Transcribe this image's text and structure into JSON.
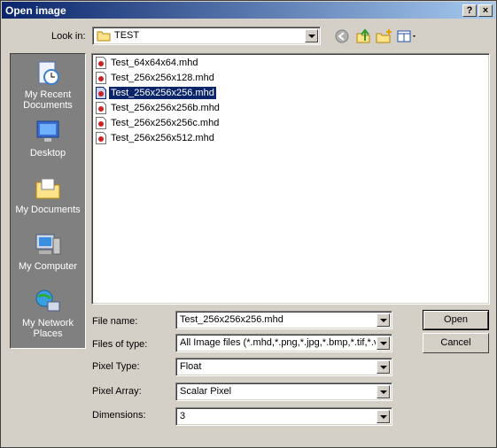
{
  "window": {
    "title": "Open image"
  },
  "titlebar": {
    "help": "?",
    "close": "×"
  },
  "lookin": {
    "label": "Look in:",
    "value": "TEST"
  },
  "places": [
    {
      "label": "My Recent Documents",
      "icon": "recent-documents-icon"
    },
    {
      "label": "Desktop",
      "icon": "desktop-icon"
    },
    {
      "label": "My Documents",
      "icon": "my-documents-icon"
    },
    {
      "label": "My Computer",
      "icon": "my-computer-icon"
    },
    {
      "label": "My Network Places",
      "icon": "network-places-icon"
    }
  ],
  "files": [
    {
      "name": "Test_64x64x64.mhd",
      "selected": false
    },
    {
      "name": "Test_256x256x128.mhd",
      "selected": false
    },
    {
      "name": "Test_256x256x256.mhd",
      "selected": true
    },
    {
      "name": "Test_256x256x256b.mhd",
      "selected": false
    },
    {
      "name": "Test_256x256x256c.mhd",
      "selected": false
    },
    {
      "name": "Test_256x256x512.mhd",
      "selected": false
    }
  ],
  "form": {
    "filename_label": "File name:",
    "filename_value": "Test_256x256x256.mhd",
    "filetype_label": "Files of type:",
    "filetype_value": "All Image files (*.mhd,*.png,*.jpg,*.bmp,*.tif,*.vtk",
    "pixeltype_label": "Pixel Type:",
    "pixeltype_value": "Float",
    "pixelarray_label": "Pixel Array:",
    "pixelarray_value": "Scalar Pixel",
    "dimensions_label": "Dimensions:",
    "dimensions_value": "3"
  },
  "buttons": {
    "open": "Open",
    "cancel": "Cancel"
  }
}
